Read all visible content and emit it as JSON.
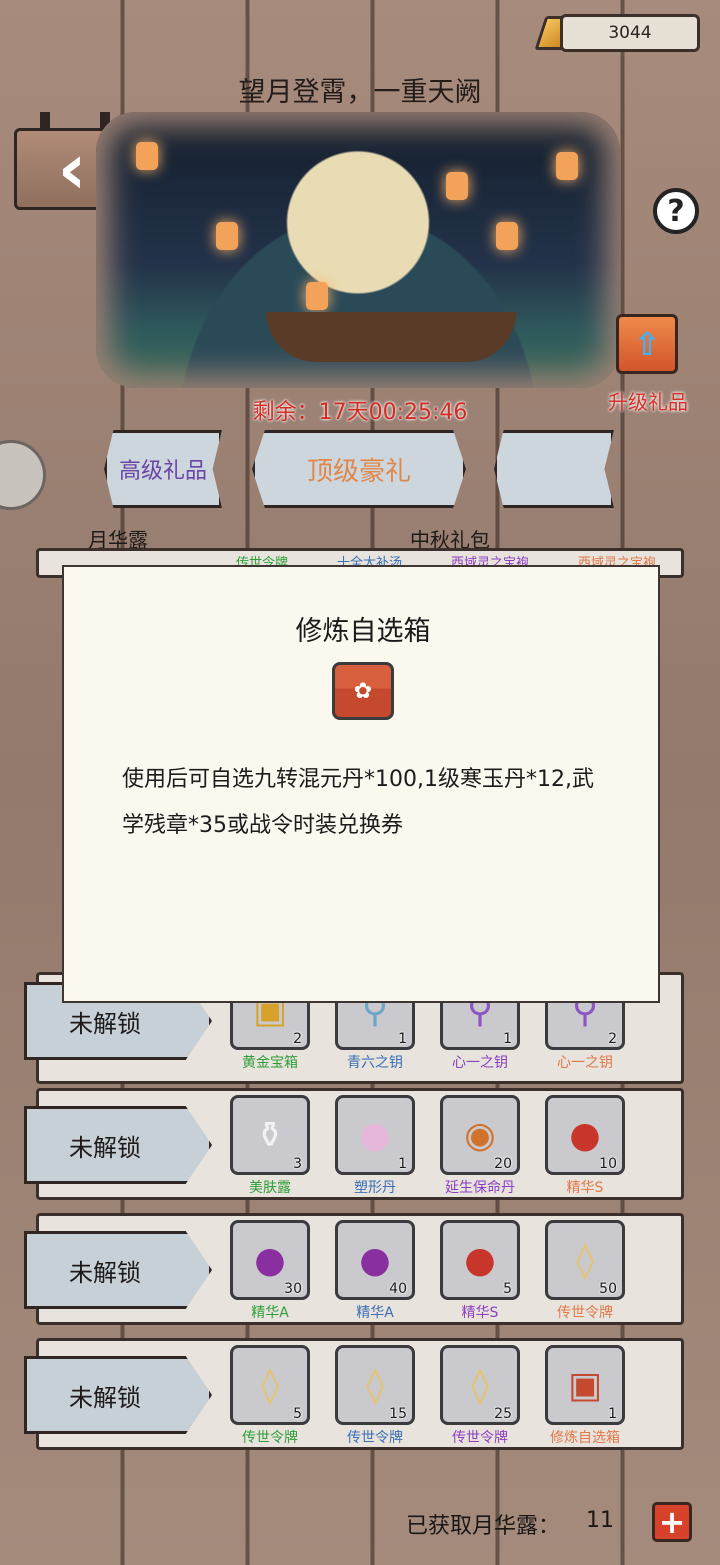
{
  "header": {
    "currency_value": "3044",
    "title": "望月登霄，一重天阙",
    "timer": "剩余：17天00:25:46",
    "upgrade_gift_label": "升级礼品"
  },
  "tabs": [
    {
      "label": "高级礼品",
      "color": "#6a45a8"
    },
    {
      "label": "顶级豪礼",
      "color": "#e0874b"
    },
    {
      "label": ""
    }
  ],
  "sub_labels": {
    "left": "月华露",
    "right": "中秋礼包"
  },
  "rows": [
    {
      "lock_label": "未解锁",
      "items": [
        {
          "name": "黄金宝箱",
          "count": "2",
          "icon": "gold-chest-icon",
          "color": "#2e9e3a"
        },
        {
          "name": "青六之钥",
          "count": "1",
          "icon": "key-icon",
          "color": "#3a6fb5"
        },
        {
          "name": "心一之钥",
          "count": "1",
          "icon": "purple-key-icon",
          "color": "#8c3fc0"
        },
        {
          "name": "心一之钥",
          "count": "2",
          "icon": "purple-key-icon",
          "color": "#e0784a"
        }
      ]
    },
    {
      "lock_label": "未解锁",
      "items": [
        {
          "name": "美肤露",
          "count": "3",
          "icon": "vase-icon",
          "color": "#2e9e3a"
        },
        {
          "name": "塑形丹",
          "count": "1",
          "icon": "pearl-icon",
          "color": "#3a6fb5"
        },
        {
          "name": "延生保命丹",
          "count": "20",
          "icon": "gourd-icon",
          "color": "#8c3fc0"
        },
        {
          "name": "精华S",
          "count": "10",
          "icon": "red-bag-icon",
          "color": "#e0784a"
        }
      ]
    },
    {
      "lock_label": "未解锁",
      "items": [
        {
          "name": "精华A",
          "count": "30",
          "icon": "purple-bag-icon",
          "color": "#2e9e3a"
        },
        {
          "name": "精华A",
          "count": "40",
          "icon": "purple-bag-icon",
          "color": "#3a6fb5"
        },
        {
          "name": "精华S",
          "count": "5",
          "icon": "red-bag-icon",
          "color": "#8c3fc0"
        },
        {
          "name": "传世令牌",
          "count": "50",
          "icon": "token-icon",
          "color": "#e0784a"
        }
      ]
    },
    {
      "lock_label": "未解锁",
      "items": [
        {
          "name": "传世令牌",
          "count": "5",
          "icon": "token-icon",
          "color": "#2e9e3a"
        },
        {
          "name": "传世令牌",
          "count": "15",
          "icon": "token-icon",
          "color": "#3a6fb5"
        },
        {
          "name": "传世令牌",
          "count": "25",
          "icon": "token-icon",
          "color": "#8c3fc0"
        },
        {
          "name": "修炼自选箱",
          "count": "1",
          "icon": "chest-icon",
          "color": "#e0784a"
        }
      ]
    }
  ],
  "partial_row_labels": [
    "传世令牌",
    "十全大补汤",
    "西域灵之宝袍",
    "西域灵之宝袍"
  ],
  "modal": {
    "title": "修炼自选箱",
    "icon": "chest-icon",
    "description": "使用后可自选九转混元丹*100,1级寒玉丹*12,武学残章*35或战令时装兑换券"
  },
  "footer": {
    "label": "已获取月华露：",
    "value": "11"
  }
}
